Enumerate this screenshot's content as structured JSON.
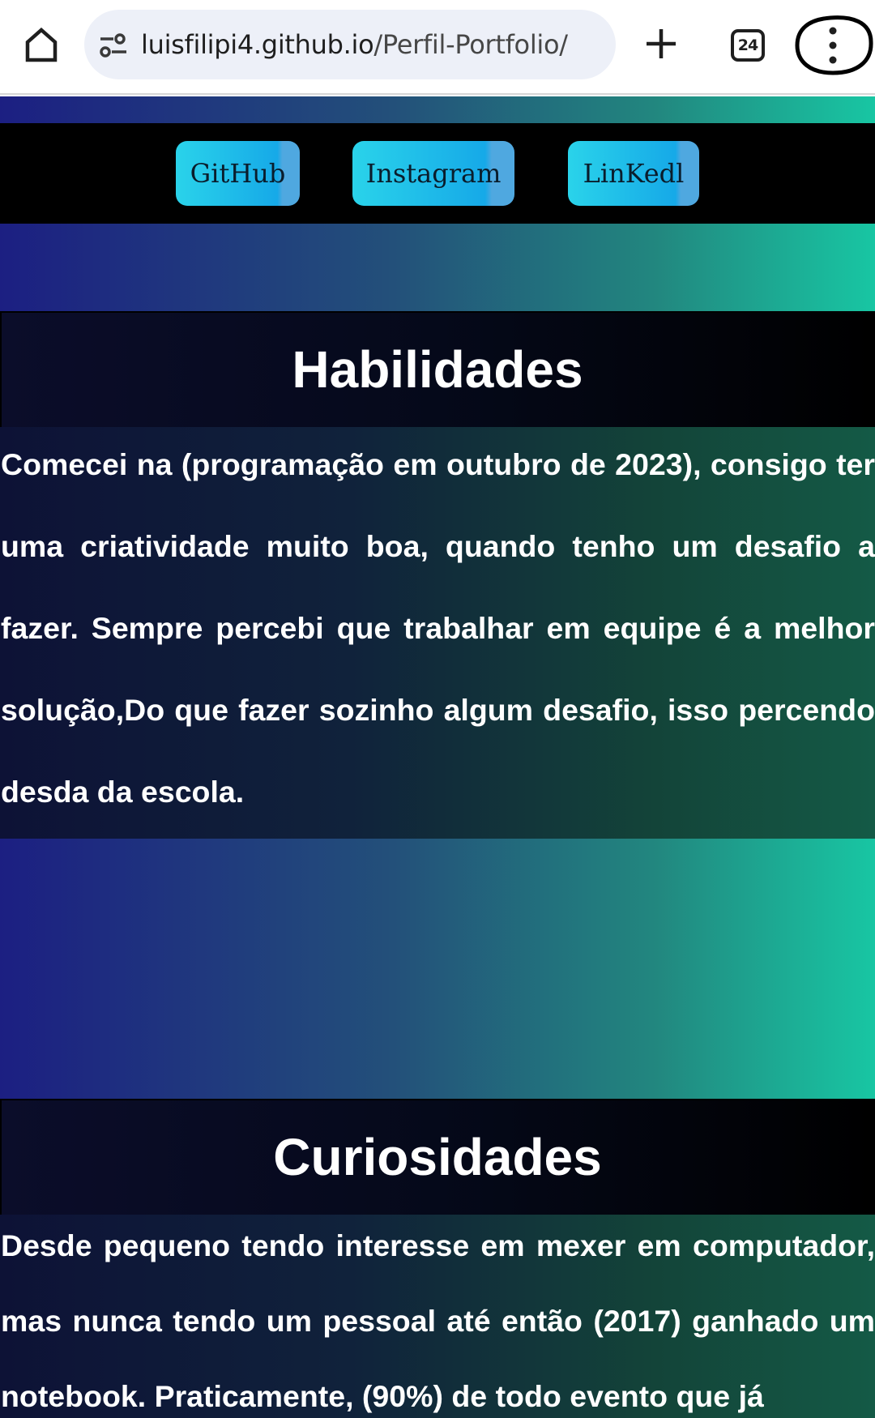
{
  "browser": {
    "url_domain": "luisfilipi4.github.io",
    "url_path": "/Perfil-Portfolio/",
    "tab_count": "24"
  },
  "social": {
    "buttons": [
      {
        "label": "GitHub"
      },
      {
        "label": "Instagram"
      },
      {
        "label": "LinKedl"
      }
    ]
  },
  "habilidades": {
    "title": "Habilidades",
    "text": "Comecei na (programação em outubro de 2023), consigo ter uma criatividade muito boa, quando tenho um desafio a fazer. Sempre percebi que trabalhar em equipe é a melhor solução,Do que fazer sozinho algum desafio, isso percendo desda da escola."
  },
  "curiosidades": {
    "title": "Curiosidades",
    "text": "Desde pequeno tendo interesse em mexer em computador, mas nunca tendo um pessoal até então (2017) ganhado um notebook. Praticamente, (90%) de todo evento que já"
  },
  "colors": {
    "gradient_start": "#1c1f82",
    "gradient_end": "#18c6a3",
    "button": "#1fc0ea",
    "header_bar": "#000000"
  },
  "icons": [
    "home-icon",
    "site-info-icon",
    "plus-icon",
    "tab-switcher-icon",
    "more-vert-icon"
  ]
}
